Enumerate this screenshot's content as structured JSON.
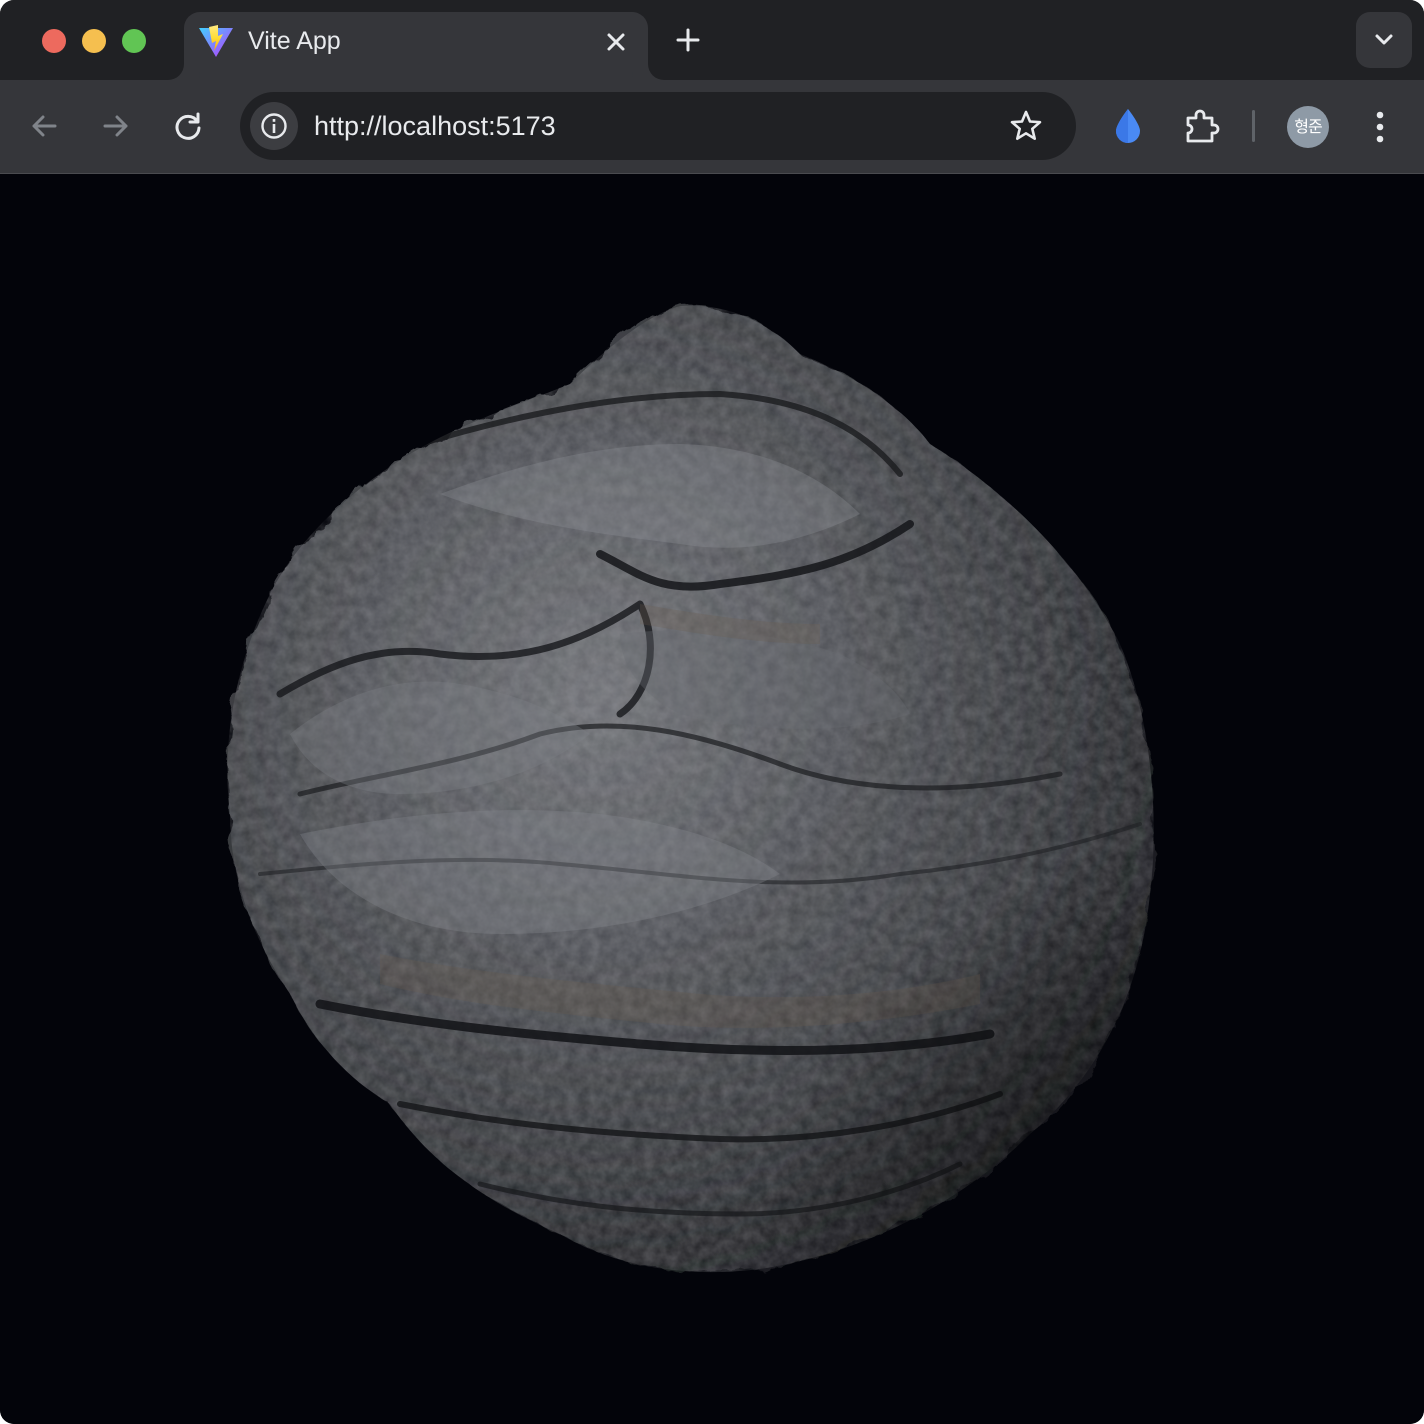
{
  "tab": {
    "title": "Vite App",
    "favicon": "vite-logo-icon"
  },
  "address_bar": {
    "url": "http://localhost:5173"
  },
  "profile": {
    "avatar_text": "형준"
  },
  "colors": {
    "accent_drop": "#4a8af4",
    "background": "#03040a"
  }
}
